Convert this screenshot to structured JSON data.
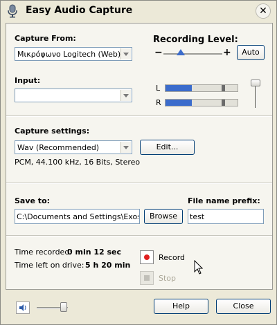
{
  "window": {
    "title": "Easy Audio Capture",
    "close_icon": "close-icon"
  },
  "capture": {
    "from_label": "Capture From:",
    "device": "Μικρόφωνο Logitech (Web)",
    "input_label": "Input:",
    "input_value": ""
  },
  "recording_level": {
    "label": "Recording Level:",
    "minus": "−",
    "plus": "+",
    "auto_label": "Auto",
    "slider_value": 0.35,
    "left_channel": "L",
    "right_channel": "R",
    "left_level": 0.42,
    "right_level": 0.42,
    "input_volume": 0.85
  },
  "settings": {
    "label": "Capture settings:",
    "format": "Wav (Recommended)",
    "edit_label": "Edit...",
    "details": "PCM, 44.100 kHz, 16 Bits, Stereo"
  },
  "save": {
    "label": "Save to:",
    "path": "C:\\Documents and Settings\\Exoskel",
    "browse_label": "Browse",
    "prefix_label": "File name prefix:",
    "prefix_value": "test"
  },
  "status": {
    "recorded_label": "Time recorded:",
    "recorded_value": "0 min 12 sec",
    "left_label": "Time left on drive:",
    "left_value": "5 h 20 min",
    "record_label": "Record",
    "stop_label": "Stop"
  },
  "footer": {
    "volume_level": 0.85,
    "help_label": "Help",
    "close_label": "Close"
  },
  "colors": {
    "accent": "#3b6ccc",
    "record": "#e02020",
    "button_border": "#003c74"
  }
}
